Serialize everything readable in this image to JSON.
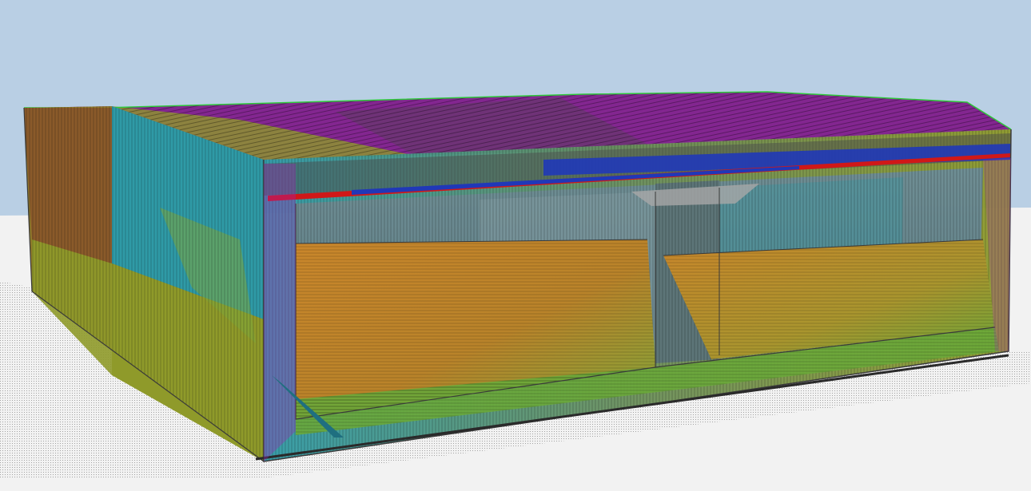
{
  "viewport": {
    "sky_color": "#b9cfe4",
    "ground_color": "#f2f2f2",
    "shadow_color": "#c8c8c8"
  },
  "model": {
    "colors": {
      "magenta": "#a21fb4",
      "teal": "#2f9aa6",
      "olive": "#8f9a2a",
      "orange": "#c9862b",
      "green": "#6aa83a",
      "slate": "#6f8e94",
      "red_beam": "#d01818",
      "blue_beam": "#2038b8",
      "edge": "#3a3a3a",
      "mesh_dark": "#4a4a4a",
      "brown": "#8a5a2a"
    }
  }
}
